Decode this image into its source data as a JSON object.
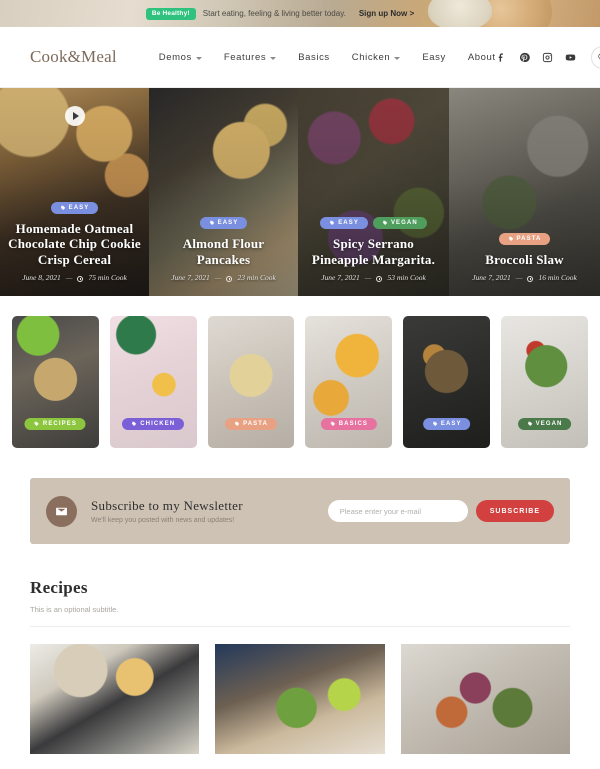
{
  "promo": {
    "badge": "Be Healthy!",
    "message": "Start eating, feeling & living better today.",
    "cta": "Sign up Now >"
  },
  "header": {
    "logo": "Cook&Meal",
    "nav": [
      {
        "label": "Demos",
        "has_dropdown": true
      },
      {
        "label": "Features",
        "has_dropdown": true
      },
      {
        "label": "Basics",
        "has_dropdown": false
      },
      {
        "label": "Chicken",
        "has_dropdown": true
      },
      {
        "label": "Easy",
        "has_dropdown": false
      },
      {
        "label": "About",
        "has_dropdown": false
      }
    ],
    "social": [
      "facebook-icon",
      "pinterest-icon",
      "instagram-icon",
      "youtube-icon"
    ],
    "search": "search-icon"
  },
  "hero": {
    "cards": [
      {
        "title": "Homemade Oatmeal Chocolate Chip Cookie Crisp Cereal",
        "tags": [
          {
            "label": "EASY",
            "color": "#7b8fe0"
          }
        ],
        "date": "June 8, 2021",
        "cook_time": "75 min Cook",
        "has_video": true
      },
      {
        "title": "Almond Flour Pancakes",
        "tags": [
          {
            "label": "EASY",
            "color": "#7b8fe0"
          }
        ],
        "date": "June 7, 2021",
        "cook_time": "23 min Cook",
        "has_video": false
      },
      {
        "title": "Spicy Serrano Pineapple Margarita.",
        "tags": [
          {
            "label": "EASY",
            "color": "#7b8fe0"
          },
          {
            "label": "VEGAN",
            "color": "#4f9e5e"
          }
        ],
        "date": "June 7, 2021",
        "cook_time": "53 min Cook",
        "has_video": false
      },
      {
        "title": "Broccoli Slaw",
        "tags": [
          {
            "label": "PASTA",
            "color": "#e9a183"
          }
        ],
        "date": "June 7, 2021",
        "cook_time": "16 min Cook",
        "has_video": false
      }
    ],
    "separator": "—"
  },
  "categories": [
    {
      "label": "RECIPES",
      "color": "#8cc63f"
    },
    {
      "label": "CHICKEN",
      "color": "#7b5fd6"
    },
    {
      "label": "PASTA",
      "color": "#e9a183"
    },
    {
      "label": "BASICS",
      "color": "#e8729f"
    },
    {
      "label": "EASY",
      "color": "#7b8fe0"
    },
    {
      "label": "VEGAN",
      "color": "#4b7a4a"
    }
  ],
  "newsletter": {
    "icon": "envelope-icon",
    "title": "Subscribe to my Newsletter",
    "subtitle": "We'll keep you posted with news and updates!",
    "input_placeholder": "Please enter your e-mail",
    "input_value": "",
    "button": "SUBSCRIBE",
    "button_color": "#d2413f",
    "panel_color": "#cdc2b4"
  },
  "recipes_section": {
    "title": "Recipes",
    "subtitle": "This is an optional subtitle.",
    "cards": [
      {
        "name": "recipe-card-1"
      },
      {
        "name": "recipe-card-2"
      },
      {
        "name": "recipe-card-3"
      }
    ]
  }
}
